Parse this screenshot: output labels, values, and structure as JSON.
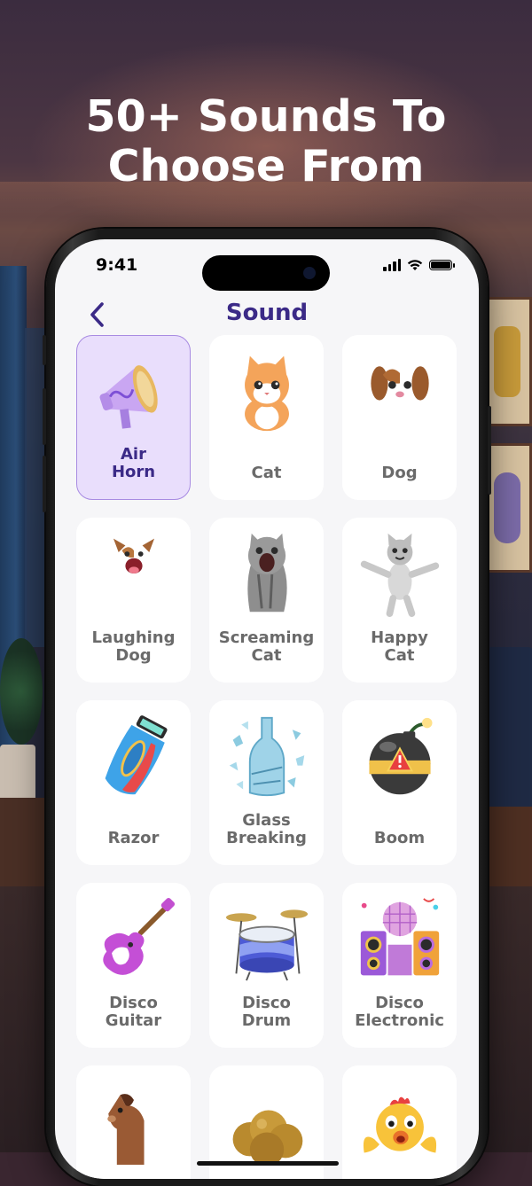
{
  "headline": {
    "line1": "50+ Sounds To",
    "line2": "Choose From"
  },
  "status_bar": {
    "time": "9:41"
  },
  "nav": {
    "title": "Sound"
  },
  "sounds": [
    {
      "line1": "Air",
      "line2": "Horn",
      "icon": "megaphone-icon",
      "selected": true
    },
    {
      "line1": "Cat",
      "line2": "",
      "icon": "cat-icon",
      "selected": false
    },
    {
      "line1": "Dog",
      "line2": "",
      "icon": "dog-icon",
      "selected": false
    },
    {
      "line1": "Laughing",
      "line2": "Dog",
      "icon": "laughing-dog-icon",
      "selected": false
    },
    {
      "line1": "Screaming",
      "line2": "Cat",
      "icon": "screaming-cat-icon",
      "selected": false
    },
    {
      "line1": "Happy",
      "line2": "Cat",
      "icon": "happy-cat-icon",
      "selected": false
    },
    {
      "line1": "Razor",
      "line2": "",
      "icon": "razor-icon",
      "selected": false
    },
    {
      "line1": "Glass",
      "line2": "Breaking",
      "icon": "glass-breaking-icon",
      "selected": false
    },
    {
      "line1": "Boom",
      "line2": "",
      "icon": "bomb-icon",
      "selected": false
    },
    {
      "line1": "Disco",
      "line2": "Guitar",
      "icon": "guitar-icon",
      "selected": false
    },
    {
      "line1": "Disco",
      "line2": "Drum",
      "icon": "drum-icon",
      "selected": false
    },
    {
      "line1": "Disco",
      "line2": "Electronic",
      "icon": "disco-speakers-icon",
      "selected": false
    },
    {
      "line1": "",
      "line2": "",
      "icon": "horse-icon",
      "selected": false
    },
    {
      "line1": "",
      "line2": "",
      "icon": "fart-cloud-icon",
      "selected": false
    },
    {
      "line1": "",
      "line2": "",
      "icon": "chicken-icon",
      "selected": false
    }
  ],
  "colors": {
    "accent": "#3b2a87",
    "selected_bg": "#e9defc",
    "selected_border": "#a88be2",
    "label": "#6a6a6a",
    "screen_bg": "#f6f6f8"
  }
}
